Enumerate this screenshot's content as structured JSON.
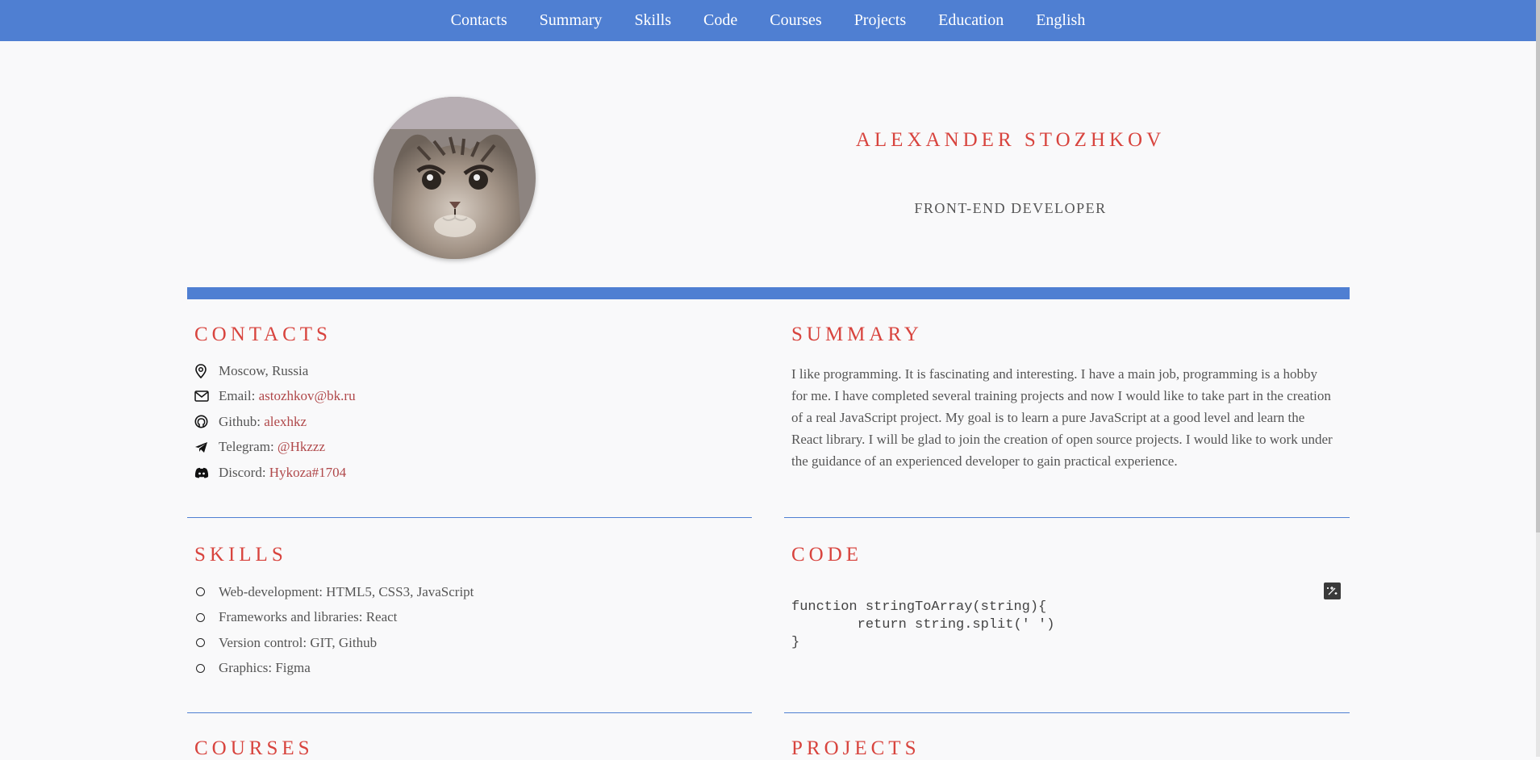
{
  "nav": {
    "items": [
      "Contacts",
      "Summary",
      "Skills",
      "Code",
      "Courses",
      "Projects",
      "Education",
      "English"
    ]
  },
  "header": {
    "name": "ALEXANDER STOZHKOV",
    "role": "FRONT-END DEVELOPER"
  },
  "contacts": {
    "title": "CONTACTS",
    "location": "Moscow, Russia",
    "items": [
      {
        "label": "Email:",
        "value": "astozhkov@bk.ru",
        "icon": "mail-icon"
      },
      {
        "label": "Github:",
        "value": "alexhkz",
        "icon": "github-icon"
      },
      {
        "label": "Telegram:",
        "value": "@Hkzzz",
        "icon": "telegram-icon"
      },
      {
        "label": "Discord:",
        "value": "Hykoza#1704",
        "icon": "discord-icon"
      }
    ]
  },
  "summary": {
    "title": "SUMMARY",
    "text": "I like programming. It is fascinating and interesting. I have a main job, programming is a hobby for me. I have completed several training projects and now I would like to take part in the creation of a real JavaScript project. My goal is to learn a pure JavaScript at a good level and learn the React library. I will be glad to join the creation of open source projects. I would like to work under the guidance of an experienced developer to gain practical experience."
  },
  "skills": {
    "title": "SKILLS",
    "items": [
      "Web-development: HTML5, CSS3, JavaScript",
      "Frameworks and libraries: React",
      "Version control: GIT, Github",
      "Graphics: Figma"
    ]
  },
  "code": {
    "title": "CODE",
    "snippet": "function stringToArray(string){\n        return string.split(' ')\n}"
  },
  "courses": {
    "title": "COURSES"
  },
  "projects": {
    "title": "PROJECTS"
  },
  "colors": {
    "accent": "#4f7fd2",
    "heading": "#d8443e",
    "link": "#b0484a",
    "background": "#f9f9fa"
  }
}
